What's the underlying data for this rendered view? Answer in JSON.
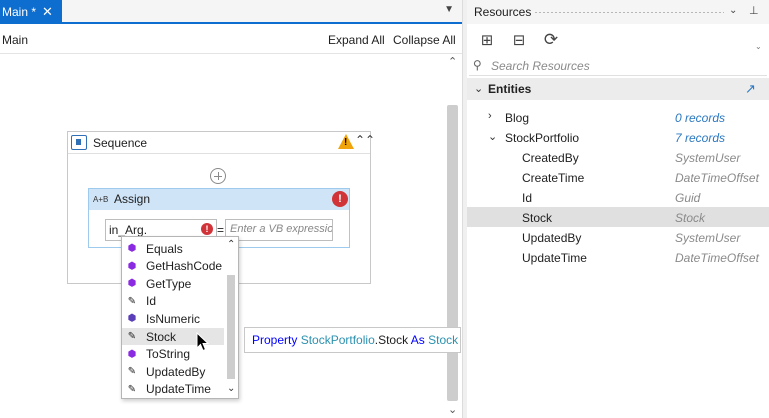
{
  "designer": {
    "tab_label": "Main *",
    "tab_close": "✕",
    "breadcrumb": "Main",
    "expand_all": "Expand All",
    "collapse_all": "Collapse All",
    "sequence": {
      "title": "Sequence",
      "warning_symbol": "!",
      "collapse_symbol": "⌃⌃"
    },
    "assign": {
      "icon_text": "A+B",
      "title": "Assign",
      "error_symbol": "!",
      "to_value": "in_Arg.",
      "equals": "=",
      "value_placeholder": "Enter a VB expression"
    },
    "intellisense": {
      "items": [
        {
          "label": "Equals",
          "icon": "method-cube-icon"
        },
        {
          "label": "GetHashCode",
          "icon": "method-cube-icon"
        },
        {
          "label": "GetType",
          "icon": "method-cube-icon"
        },
        {
          "label": "Id",
          "icon": "property-wrench-icon"
        },
        {
          "label": "IsNumeric",
          "icon": "extension-method-icon"
        },
        {
          "label": "Stock",
          "icon": "property-wrench-icon",
          "selected": true
        },
        {
          "label": "ToString",
          "icon": "method-cube-icon"
        },
        {
          "label": "UpdatedBy",
          "icon": "property-wrench-icon"
        },
        {
          "label": "UpdateTime",
          "icon": "property-wrench-icon"
        }
      ]
    },
    "tooltip": {
      "kw1": "Property",
      "type1": "StockPortfolio",
      "mid": ".Stock",
      "kw2": "As",
      "type2": "Stock"
    }
  },
  "resources": {
    "title": "Resources",
    "search_placeholder": "Search Resources",
    "entities_title": "Entities",
    "rows": [
      {
        "name": "Blog",
        "value": "0 records",
        "expander": "›",
        "level": 0,
        "link": true
      },
      {
        "name": "StockPortfolio",
        "value": "7 records",
        "expander": "⌄",
        "level": 0,
        "link": true
      },
      {
        "name": "CreatedBy",
        "value": "SystemUser",
        "level": 1
      },
      {
        "name": "CreateTime",
        "value": "DateTimeOffset",
        "level": 1
      },
      {
        "name": "Id",
        "value": "Guid",
        "level": 1
      },
      {
        "name": "Stock",
        "value": "Stock",
        "level": 1,
        "selected": true
      },
      {
        "name": "UpdatedBy",
        "value": "SystemUser",
        "level": 1
      },
      {
        "name": "UpdateTime",
        "value": "DateTimeOffset",
        "level": 1
      }
    ]
  },
  "colors": {
    "accent": "#0e6ecf",
    "error": "#d13438",
    "warning": "#f0a30a",
    "link": "#2b78c2"
  }
}
